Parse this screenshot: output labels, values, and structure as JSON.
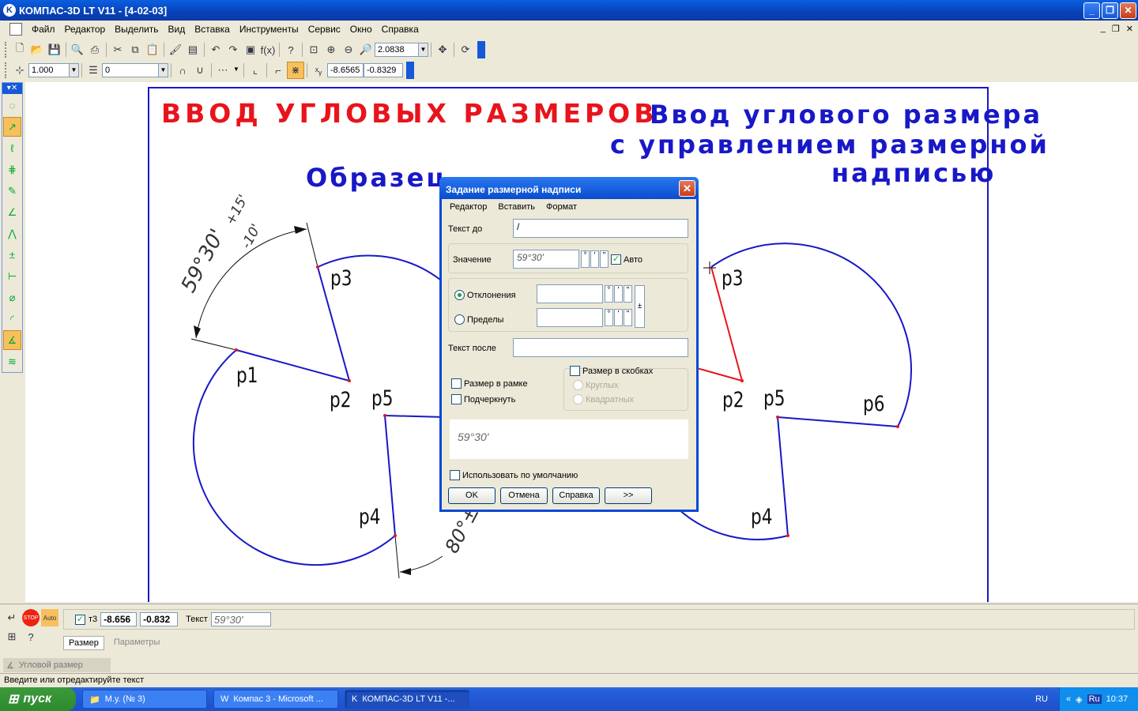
{
  "window": {
    "title": "КОМПАС-3D LT V11 - [4-02-03]",
    "icon": "kompas-logo-icon"
  },
  "menubar": [
    "Файл",
    "Редактор",
    "Выделить",
    "Вид",
    "Вставка",
    "Инструменты",
    "Сервис",
    "Окно",
    "Справка"
  ],
  "toolbar1": {
    "zoom_value": "2.0838"
  },
  "toolbar2": {
    "scale_value": "1.000",
    "layer_value": "0",
    "coord_x": "-8.6565",
    "coord_y": "-0.8329"
  },
  "drawing": {
    "heading_red": "ВВОД УГЛОВЫХ РАЗМЕРОВ",
    "heading_blue_line1": "Ввод углового размера",
    "heading_blue_line2": "с управлением размерной",
    "heading_blue_line3": "надписью",
    "sample_label": "Образец",
    "left_points": [
      "p1",
      "p2",
      "p3",
      "p4",
      "p5"
    ],
    "right_points": [
      "p3",
      "p2",
      "p5",
      "p6",
      "p4"
    ],
    "dim_text_main": "59°30'",
    "dim_text_upper": "+15'",
    "dim_text_lower": "-10'",
    "dim_text_bottom": "80°±1"
  },
  "dialog": {
    "title": "Задание размерной надписи",
    "menu": [
      "Редактор",
      "Вставить",
      "Формат"
    ],
    "text_before_label": "Текст до",
    "text_before_value": "/",
    "value_label": "Значение",
    "value_value": "59°30'",
    "units": [
      "°",
      "'",
      "\""
    ],
    "auto_label": "Авто",
    "auto_checked": true,
    "deviation_label": "Отклонения",
    "limits_label": "Пределы",
    "plusminus": "±",
    "text_after_label": "Текст после",
    "framed_label": "Размер в рамке",
    "underline_label": "Подчеркнуть",
    "brackets_label": "Размер в скобках",
    "round_label": "Круглых",
    "square_label": "Квадратных",
    "preview_text": "59°30'",
    "default_label": "Использовать по умолчанию",
    "btn_ok": "OK",
    "btn_cancel": "Отмена",
    "btn_help": "Справка",
    "btn_more": ">>"
  },
  "property_panel": {
    "t3_label": "т3",
    "t3_x": "-8.656",
    "t3_y": "-0.832",
    "text_label": "Текст",
    "text_value": "59°30'",
    "tab_size": "Размер",
    "tab_params": "Параметры",
    "command_title": "Угловой размер"
  },
  "status_text": "Введите или отредактируйте текст",
  "taskbar": {
    "start_label": "пуск",
    "tasks": [
      "М.у. (№ 3)",
      "Компас 3 - Microsoft ...",
      "КОМПАС-3D LT V11 -..."
    ],
    "lang": "RU",
    "tray_lang": "Ru",
    "clock": "10:37"
  },
  "colors": {
    "blue_line": "#1818c8",
    "red_line": "#e8141c",
    "xp_blue": "#0a48d8"
  }
}
